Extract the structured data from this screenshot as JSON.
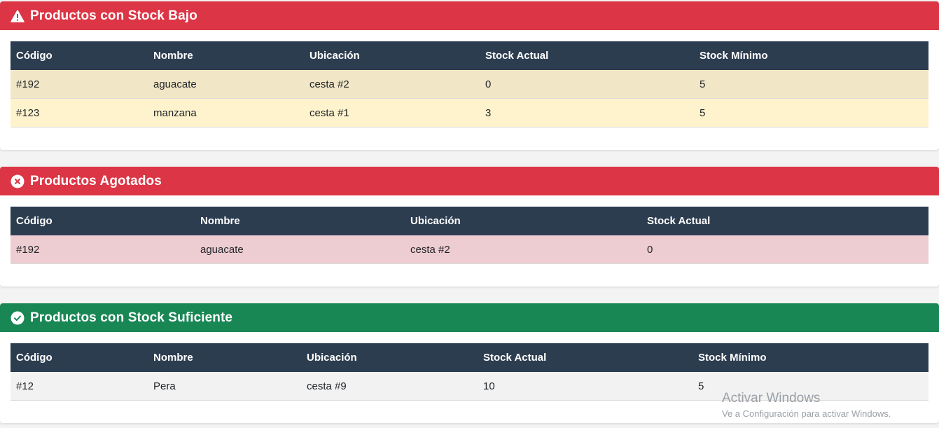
{
  "colors": {
    "danger": "#dc3545",
    "success": "#198754",
    "table_header": "#2d3d50",
    "row_warning_dark": "#f1e6c6",
    "row_warning_light": "#fff3cd",
    "row_danger": "#edcdd1",
    "row_neutral": "#f2f2f2"
  },
  "low_stock": {
    "title": "Productos con Stock Bajo",
    "icon": "warning-triangle-icon",
    "headers": [
      "Código",
      "Nombre",
      "Ubicación",
      "Stock Actual",
      "Stock Mínimo"
    ],
    "rows": [
      [
        "#192",
        "aguacate",
        "cesta #2",
        "0",
        "5"
      ],
      [
        "#123",
        "manzana",
        "cesta #1",
        "3",
        "5"
      ]
    ]
  },
  "out_of_stock": {
    "title": "Productos Agotados",
    "icon": "x-circle-icon",
    "headers": [
      "Código",
      "Nombre",
      "Ubicación",
      "Stock Actual"
    ],
    "rows": [
      [
        "#192",
        "aguacate",
        "cesta #2",
        "0"
      ]
    ]
  },
  "sufficient_stock": {
    "title": "Productos con Stock Suficiente",
    "icon": "check-circle-icon",
    "headers": [
      "Código",
      "Nombre",
      "Ubicación",
      "Stock Actual",
      "Stock Mínimo"
    ],
    "rows": [
      [
        "#12",
        "Pera",
        "cesta #9",
        "10",
        "5"
      ]
    ]
  },
  "watermark": {
    "title": "Activar Windows",
    "subtitle": "Ve a Configuración para activar Windows."
  }
}
